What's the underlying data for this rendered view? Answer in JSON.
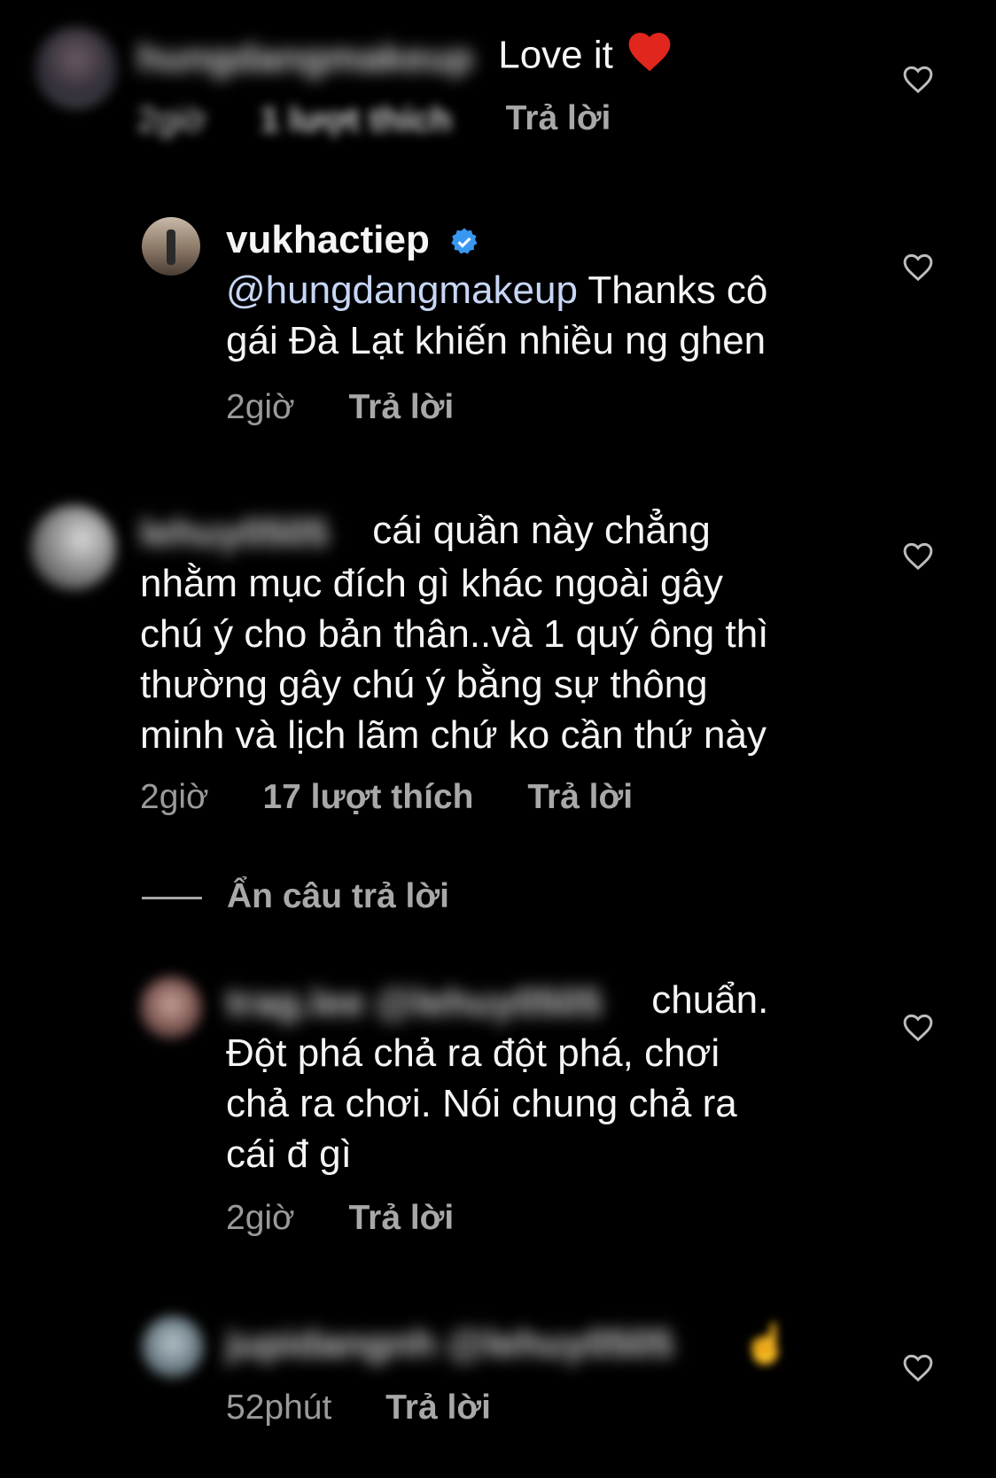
{
  "comments": [
    {
      "username_blurred": "hungdangmakeup",
      "text_suffix": "Love it",
      "time_blurred": "2giờ",
      "likes_blurred": "1 lượt thích",
      "reply": "Trả lời"
    },
    {
      "username": "vukhactiep",
      "mention": "@hungdangmakeup",
      "text_line1": " Thanks cô",
      "text_line2": "gái Đà Lạt khiến nhiều ng ghen",
      "time": "2giờ",
      "reply": "Trả lời"
    },
    {
      "username_blurred": "lehuy0505",
      "text_line1": "cái quần này chẳng",
      "text_line2": "nhằm mục đích gì khác ngoài gây",
      "text_line3": "chú ý cho bản thân..và 1 quý ông thì",
      "text_line4": "thường gây chú ý bằng sự thông",
      "text_line5": "minh và lịch lãm chứ ko cần thứ này",
      "time": "2giờ",
      "likes": "17 lượt thích",
      "reply": "Trả lời"
    },
    {
      "username_blurred": "trag.lee @lehuy0505",
      "text_line1": "chuẩn.",
      "text_line2": "Đột phá chả ra đột phá, chơi",
      "text_line3": "chả ra chơi. Nói chung chả ra",
      "text_line4": "cái đ gì",
      "time": "2giờ",
      "reply": "Trả lời"
    },
    {
      "username_blurred": "jupidangnh @lehuy0505",
      "time": "52phút",
      "reply": "Trả lời"
    }
  ],
  "hide_replies": "Ẩn câu trả lời",
  "colors": {
    "background": "#000000",
    "text": "#f5f5f5",
    "meta": "#9a9a9a",
    "verified": "#3897f0",
    "heart_emoji": "#e0261d"
  }
}
